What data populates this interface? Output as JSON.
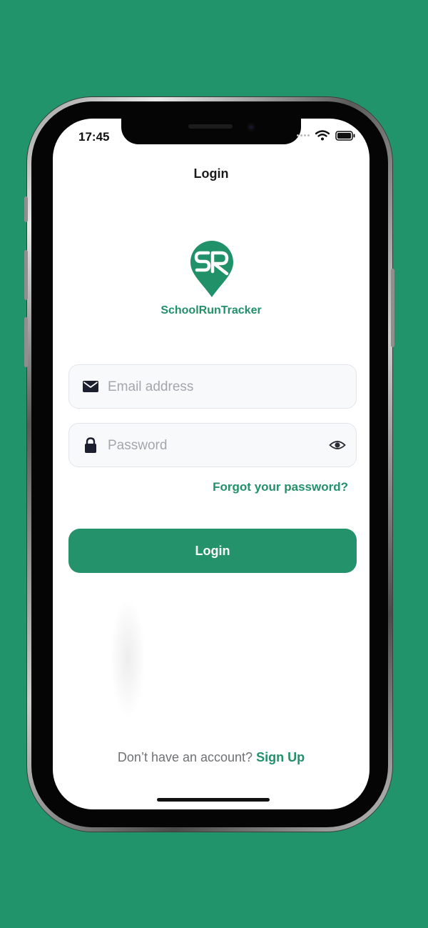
{
  "status_bar": {
    "time": "17:45"
  },
  "nav": {
    "title": "Login"
  },
  "brand": {
    "name": "SchoolRunTracker",
    "color": "#21916a"
  },
  "form": {
    "email": {
      "placeholder": "Email address",
      "value": "",
      "icon": "envelope-icon"
    },
    "password": {
      "placeholder": "Password",
      "value": "",
      "icon": "lock-icon",
      "toggle_icon": "eye-icon"
    },
    "forgot_label": "Forgot your password?",
    "submit_label": "Login"
  },
  "footer": {
    "prompt": "Don’t have an account?",
    "link_label": "Sign Up"
  },
  "colors": {
    "background": "#22946b",
    "accent": "#24926a"
  }
}
